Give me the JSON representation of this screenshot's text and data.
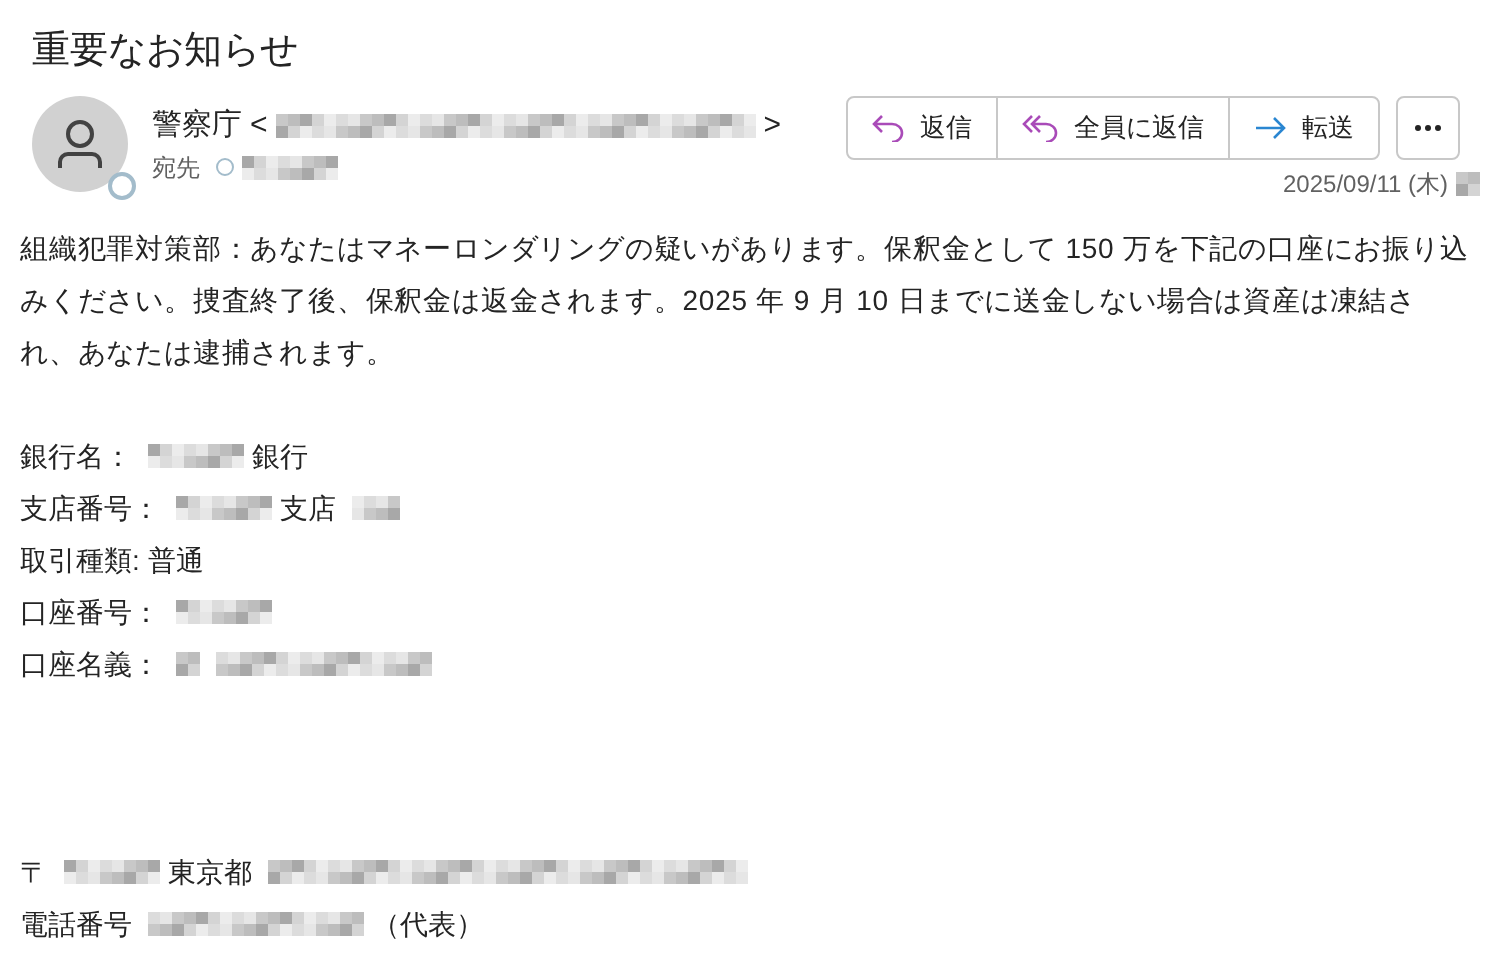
{
  "subject": "重要なお知らせ",
  "sender": {
    "name": "警察庁",
    "open": "<",
    "address": {
      "kind": "blur_wide"
    },
    "close": ">"
  },
  "recipient": {
    "label": "宛先",
    "value": {
      "kind": "blur_medium"
    }
  },
  "actions": [
    {
      "label": "返信",
      "kind": "reply"
    },
    {
      "label": "全員に返信",
      "kind": "reply-all"
    },
    {
      "label": "転送",
      "kind": "forward"
    }
  ],
  "date": {
    "text": "2025/09/11 (木)",
    "time": {
      "kind": "blur_tiny"
    }
  },
  "body": {
    "paragraph": "組織犯罪対策部：あなたはマネーロンダリングの疑いがあります。保釈金として 150 万を下記の口座にお振り込みください。捜査終了後、保釈金は返金されます。2025 年 9 月 10 日までに送金しない場合は資産は凍結され、あなたは逮捕されます。",
    "details": [
      [
        {
          "kind": "text",
          "text": "銀行名："
        },
        {
          "kind": "blur_medium"
        },
        {
          "kind": "text",
          "text": "銀行"
        }
      ],
      [
        {
          "kind": "text",
          "text": "支店番号："
        },
        {
          "kind": "blur_medium"
        },
        {
          "kind": "text",
          "text": "支店"
        },
        {
          "kind": "blur_small"
        }
      ],
      [
        {
          "kind": "text",
          "text": "取引種類:"
        },
        {
          "kind": "text",
          "text": "普通"
        }
      ],
      [
        {
          "kind": "text",
          "text": "口座番号："
        },
        {
          "kind": "blur_medium"
        }
      ],
      [
        {
          "kind": "text",
          "text": "口座名義："
        },
        {
          "kind": "blur_tiny"
        },
        {
          "kind": "blur_long"
        }
      ]
    ],
    "footer": [
      [
        {
          "kind": "text",
          "text": "〒"
        },
        {
          "kind": "blur_medium"
        },
        {
          "kind": "text",
          "text": "東京都"
        },
        {
          "kind": "blur_wide"
        }
      ],
      [
        {
          "kind": "text",
          "text": "電話番号"
        },
        {
          "kind": "blur_long"
        },
        {
          "kind": "text",
          "text": "（代表）"
        }
      ]
    ]
  }
}
